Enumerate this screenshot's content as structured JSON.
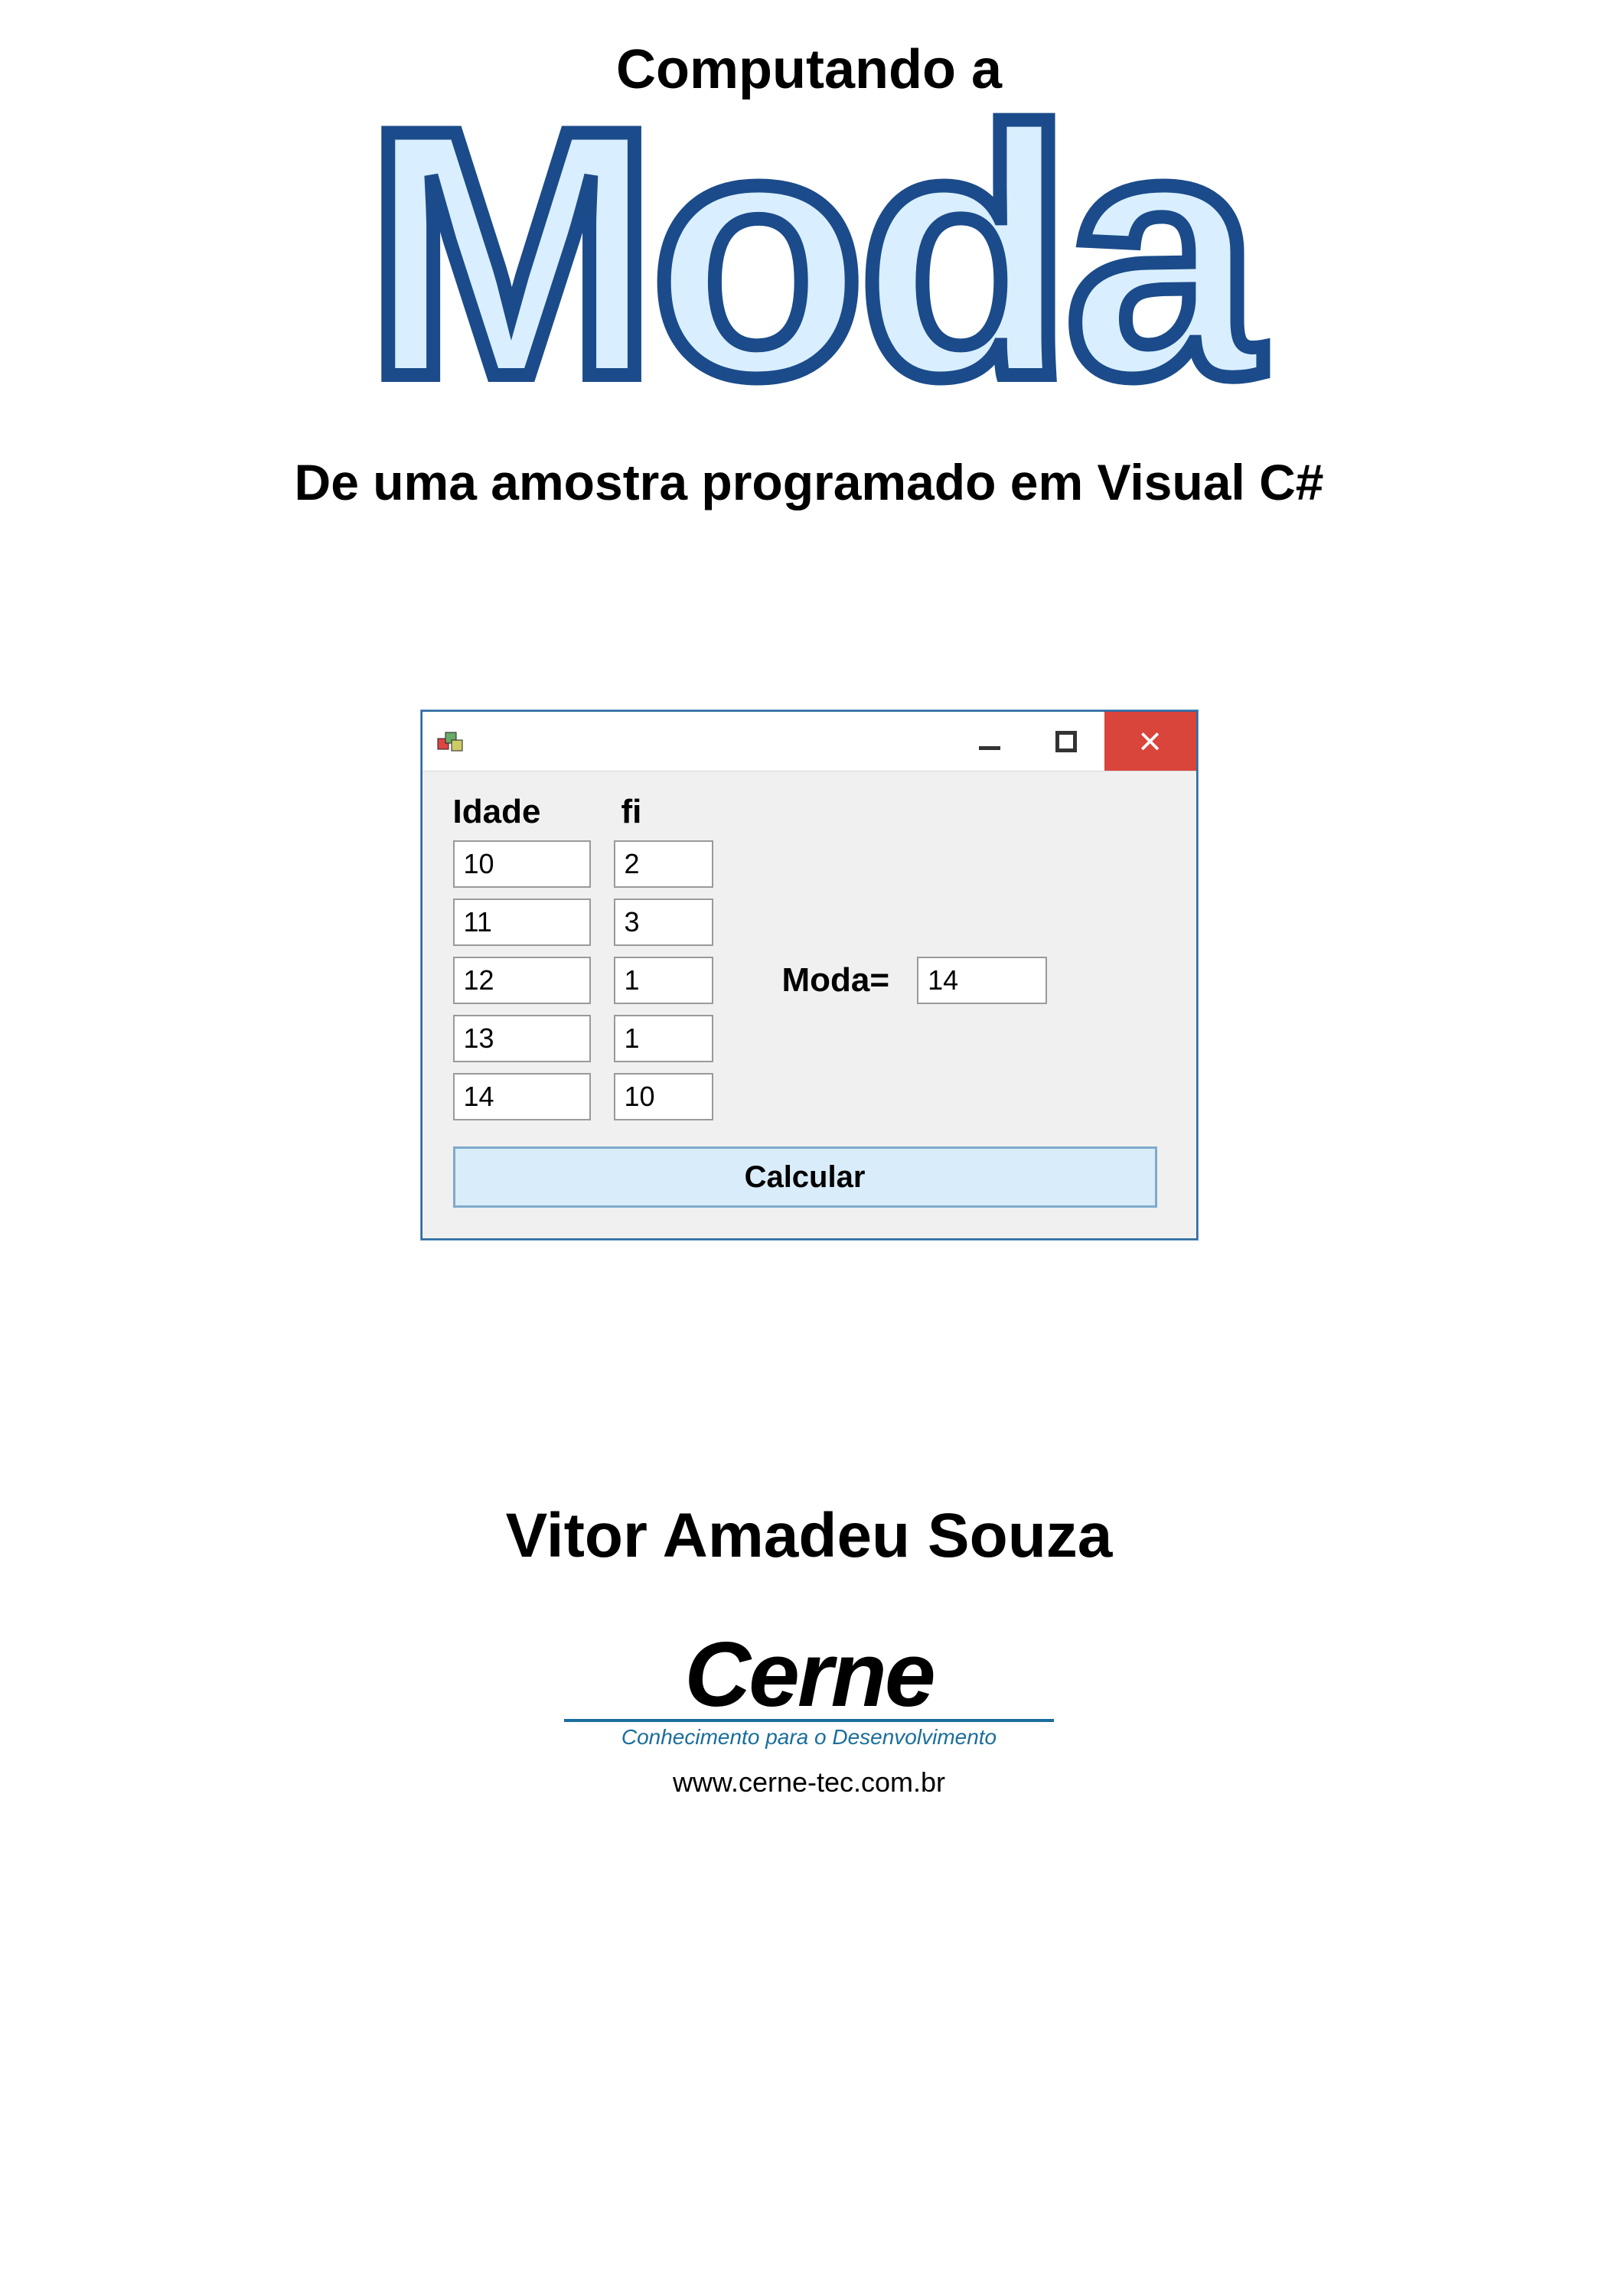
{
  "header": {
    "pretitle": "Computando a",
    "title": "Moda",
    "subtitle": "De uma amostra programado em Visual C#"
  },
  "form": {
    "columns": {
      "idade": "Idade",
      "fi": "fi"
    },
    "rows": [
      {
        "idade": "10",
        "fi": "2"
      },
      {
        "idade": "11",
        "fi": "3"
      },
      {
        "idade": "12",
        "fi": "1"
      },
      {
        "idade": "13",
        "fi": "1"
      },
      {
        "idade": "14",
        "fi": "10"
      }
    ],
    "result_label": "Moda=",
    "result_value": "14",
    "button": "Calcular"
  },
  "author": "Vitor Amadeu Souza",
  "logo": {
    "name": "Cerne",
    "tagline": "Conhecimento para o Desenvolvimento",
    "url": "www.cerne-tec.com.br"
  }
}
